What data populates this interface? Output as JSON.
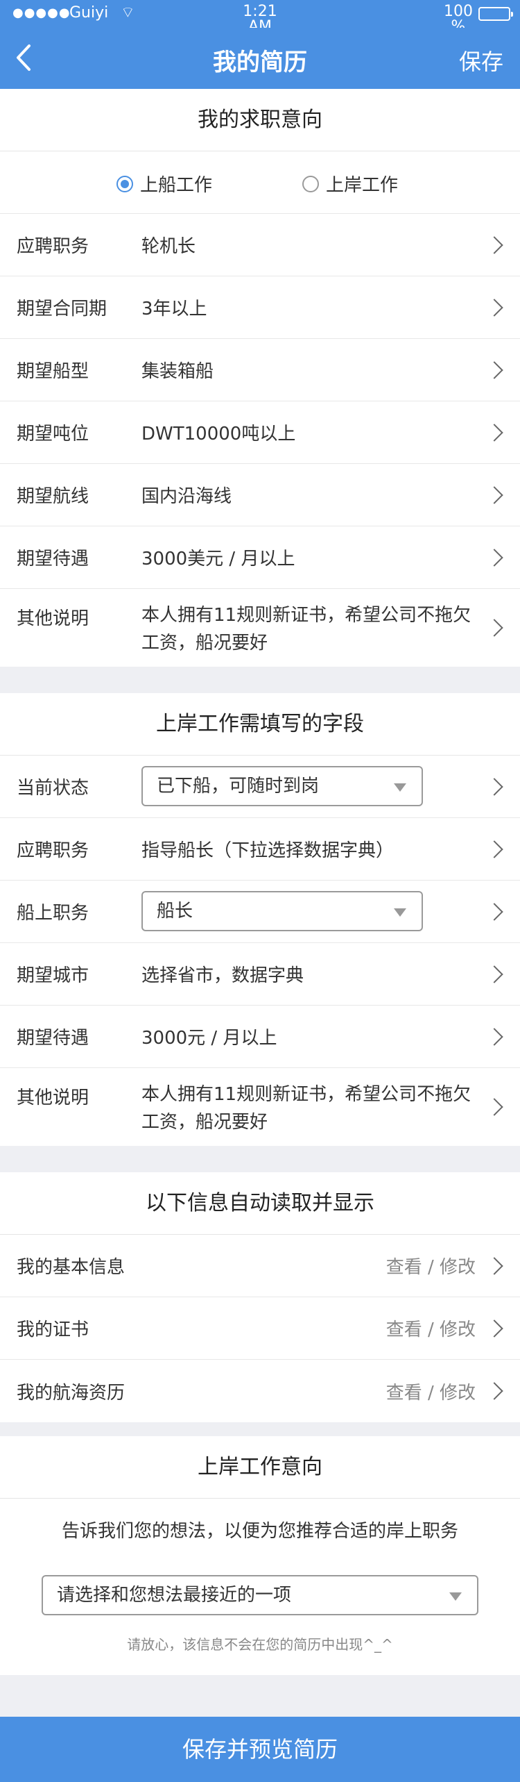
{
  "status": {
    "signal": "●●●●●",
    "carrier": "Guiyi",
    "wifi": "⌔",
    "time": "1:21 AM",
    "battery": "100 %"
  },
  "nav": {
    "title": "我的简历",
    "save": "保存"
  },
  "job_intent": {
    "title": "我的求职意向",
    "radio_ship": "上船工作",
    "radio_shore": "上岸工作",
    "rows": [
      {
        "label": "应聘职务",
        "value": "轮机长"
      },
      {
        "label": "期望合同期",
        "value": "3年以上"
      },
      {
        "label": "期望船型",
        "value": "集装箱船"
      },
      {
        "label": "期望吨位",
        "value": "DWT10000吨以上"
      },
      {
        "label": "期望航线",
        "value": "国内沿海线"
      },
      {
        "label": "期望待遇",
        "value": "3000美元 / 月以上"
      },
      {
        "label": "其他说明",
        "value": "本人拥有11规则新证书，希望公司不拖欠工资，船况要好"
      }
    ]
  },
  "shore_fields": {
    "title": "上岸工作需填写的字段",
    "current_status_label": "当前状态",
    "current_status_value": "已下船，可随时到岗",
    "position_label": "应聘职务",
    "position_value": "指导船长（下拉选择数据字典）",
    "ship_role_label": "船上职务",
    "ship_role_value": "船长",
    "city_label": "期望城市",
    "city_value": "选择省市，数据字典",
    "salary_label": "期望待遇",
    "salary_value": "3000元 / 月以上",
    "other_label": "其他说明",
    "other_value": "本人拥有11规则新证书，希望公司不拖欠工资，船况要好"
  },
  "auto_info": {
    "title": "以下信息自动读取并显示",
    "rows": [
      {
        "label": "我的基本信息",
        "action": "查看 / 修改"
      },
      {
        "label": "我的证书",
        "action": "查看 / 修改"
      },
      {
        "label": "我的航海资历",
        "action": "查看 / 修改"
      }
    ]
  },
  "shore_intent": {
    "title": "上岸工作意向",
    "desc": "告诉我们您的想法，以便为您推荐合适的岸上职务",
    "select_placeholder": "请选择和您想法最接近的一项",
    "note": "请放心，该信息不会在您的简历中出现^_^"
  },
  "bottom_button": "保存并预览简历",
  "colors": {
    "brand": "#4a90e2",
    "background": "#eeeff3"
  }
}
